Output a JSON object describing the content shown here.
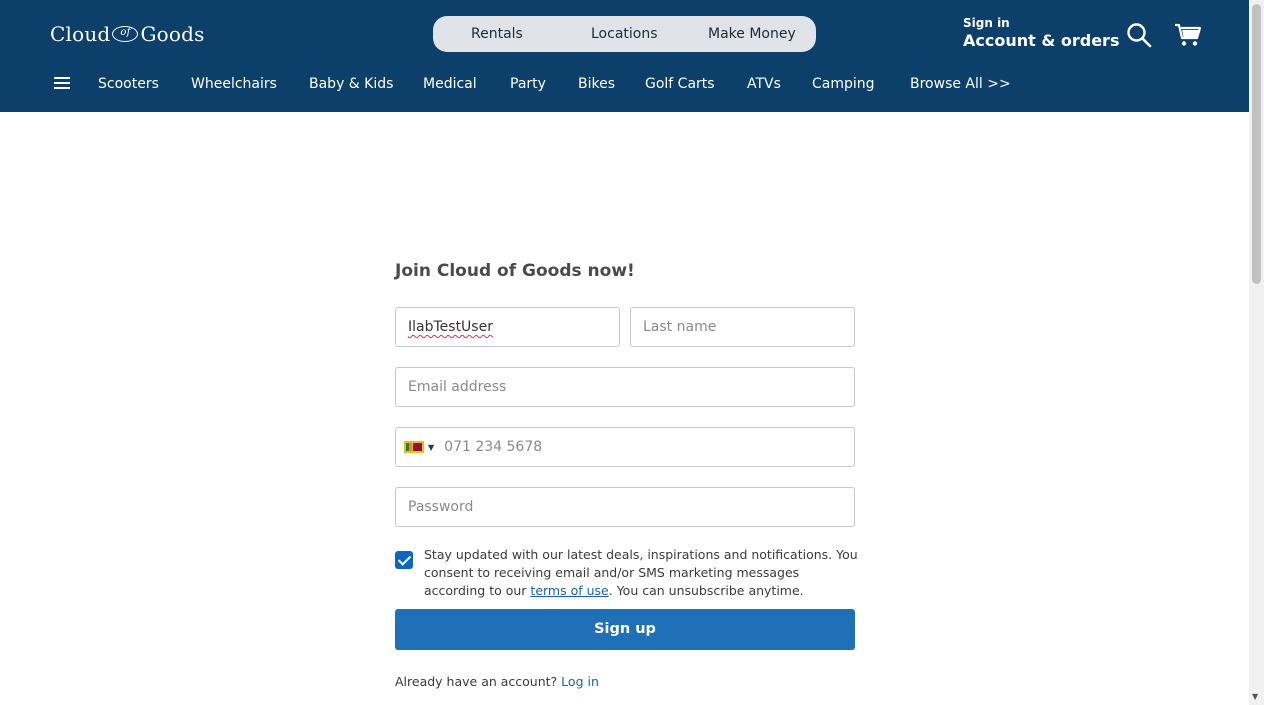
{
  "header": {
    "logo_left": "Cloud",
    "logo_mid": "of",
    "logo_right": "Goods",
    "pill_nav": [
      {
        "label": "Rentals"
      },
      {
        "label": "Locations"
      },
      {
        "label": "Make Money"
      }
    ],
    "sign_in_small": "Sign in",
    "sign_in_big": "Account & orders",
    "icons": {
      "search": "search-icon",
      "cart": "cart-icon",
      "menu": "hamburger-menu-icon"
    },
    "colors": {
      "header_bg": "#0d3f6b",
      "pill_bg": "#e0e4e9"
    }
  },
  "categories": [
    {
      "label": "Scooters"
    },
    {
      "label": "Wheelchairs"
    },
    {
      "label": "Baby & Kids"
    },
    {
      "label": "Medical"
    },
    {
      "label": "Party"
    },
    {
      "label": "Bikes"
    },
    {
      "label": "Golf Carts"
    },
    {
      "label": "ATVs"
    },
    {
      "label": "Camping"
    },
    {
      "label": "Browse All >>"
    }
  ],
  "form": {
    "title": "Join Cloud of Goods now!",
    "first_name_value": "IlabTestUser",
    "last_name_placeholder": "Last name",
    "email_placeholder": "Email address",
    "phone_placeholder": "071 234 5678",
    "phone_country_icon": "sri-lanka-flag-icon",
    "password_placeholder": "Password",
    "consent_checked": true,
    "consent_text_1": "Stay updated with our latest deals, inspirations and notifications. You consent to receiving email and/or SMS marketing messages according to our ",
    "consent_link": "terms of use",
    "consent_text_2": ". You can unsubscribe anytime.",
    "signup_label": "Sign up",
    "already_text": "Already have an account?",
    "login_link": "Log in",
    "colors": {
      "button": "#2070b8",
      "checkbox": "#0b66c3",
      "link": "#1565a8"
    }
  }
}
